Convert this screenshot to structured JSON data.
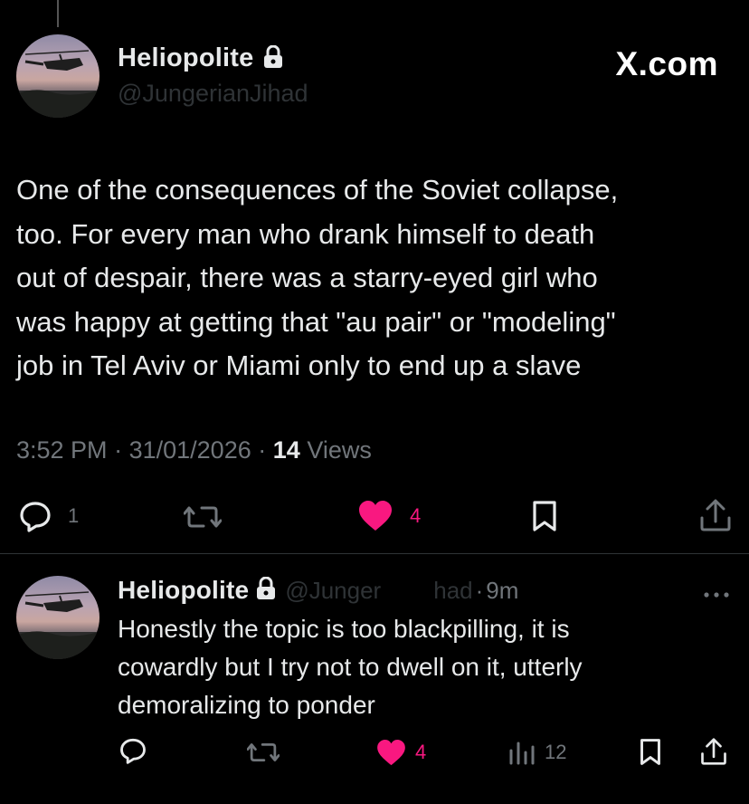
{
  "main_post": {
    "author_name": "Heliopolite",
    "author_handle": "@JungerianJihad",
    "brand": "X.com",
    "text_lines": [
      "One of the consequences of the Soviet collapse,",
      "too. For every man who drank himself to death",
      "out of despair, there was a starry-eyed girl who",
      "was happy at getting that \"au pair\" or \"modeling\"",
      "job in Tel Aviv or Miami only to end up a slave"
    ],
    "time": "3:52 PM",
    "date": "31/01/2026",
    "views_count": "14",
    "views_label": "Views",
    "reply_count": "1",
    "like_count": "4"
  },
  "reply": {
    "author_name": "Heliopolite",
    "author_handle_visible": "@Junger",
    "author_handle_tail": "had",
    "age": "9m",
    "text_lines": [
      "Honestly the topic is too blackpilling, it is",
      "cowardly but I try not to dwell on it, utterly",
      "demoralizing to ponder"
    ],
    "like_count": "4",
    "views_count": "12"
  },
  "icons": {
    "reply": "reply-icon",
    "repost": "repost-icon",
    "like": "heart-icon",
    "bookmark": "bookmark-icon",
    "share": "share-icon",
    "views": "views-icon",
    "more": "more-icon",
    "lock": "lock-icon"
  },
  "colors": {
    "background": "#000000",
    "text": "#e7e9ea",
    "muted": "#71767b",
    "like": "#f91880",
    "divider": "#2f3336"
  }
}
